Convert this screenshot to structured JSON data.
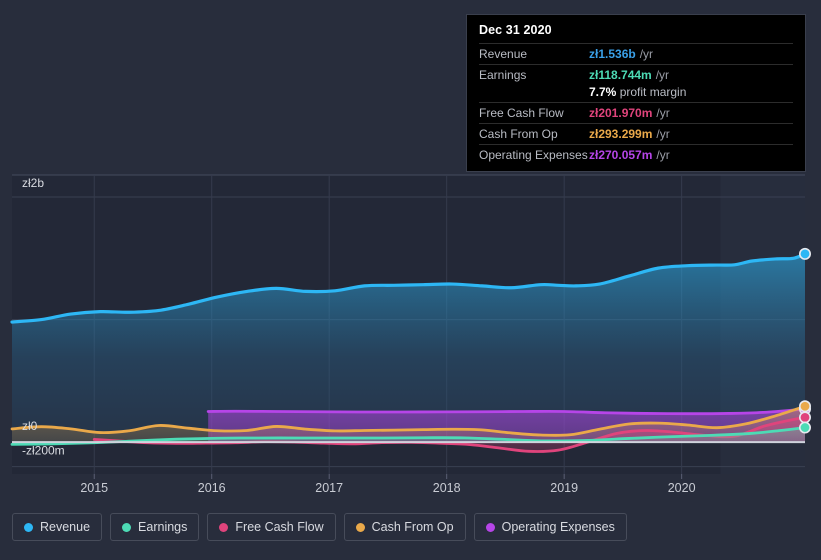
{
  "colors": {
    "background": "#282d3c",
    "plot_background": "#232837",
    "zero_line": "#cfd3dc",
    "grid": "#3a4052",
    "revenue": "#2db7f5",
    "earnings": "#4ddbb5",
    "free_cash_flow": "#e0447c",
    "cash_from_op": "#eaa94a",
    "operating_expenses": "#b645e8",
    "tooltip_bg": "#000000",
    "text": "#d9dbe1"
  },
  "tooltip": {
    "name": "chart-tooltip",
    "date": "Dec 31 2020",
    "rows": [
      {
        "label": "Revenue",
        "value": "zł1.536b",
        "unit": "/yr",
        "color": "#3aa0e8"
      },
      {
        "label": "Earnings",
        "value": "zł118.744m",
        "unit": "/yr",
        "color": "#4ddbb5"
      },
      {
        "label": "Free Cash Flow",
        "value": "zł201.970m",
        "unit": "/yr",
        "color": "#e0447c"
      },
      {
        "label": "Cash From Op",
        "value": "zł293.299m",
        "unit": "/yr",
        "color": "#eaa94a"
      },
      {
        "label": "Operating Expenses",
        "value": "zł270.057m",
        "unit": "/yr",
        "color": "#b645e8"
      }
    ],
    "profit_margin_value": "7.7%",
    "profit_margin_label": "profit margin"
  },
  "legend": {
    "items": [
      {
        "label": "Revenue",
        "color": "#2db7f5"
      },
      {
        "label": "Earnings",
        "color": "#4ddbb5"
      },
      {
        "label": "Free Cash Flow",
        "color": "#e0447c"
      },
      {
        "label": "Cash From Op",
        "color": "#eaa94a"
      },
      {
        "label": "Operating Expenses",
        "color": "#b645e8"
      }
    ]
  },
  "chart_data": {
    "type": "area",
    "title": "",
    "xlabel": "",
    "ylabel": "",
    "currency": "zł",
    "x_tick_labels": [
      "2015",
      "2016",
      "2017",
      "2018",
      "2019",
      "2020"
    ],
    "x_tick_values": [
      2015,
      2016,
      2017,
      2018,
      2019,
      2020
    ],
    "y_tick_labels": [
      "zł2b",
      "zł0",
      "-zł200m"
    ],
    "y_tick_values": [
      2000,
      0,
      -200
    ],
    "y_units": "millions",
    "ylim": [
      -260,
      2180
    ],
    "xlim": [
      2014.3,
      2021.05
    ],
    "grid": true,
    "legend_position": "bottom",
    "zero_line": 0,
    "forecast_start": 2020.33,
    "series": [
      {
        "name": "Revenue",
        "key": "revenue",
        "color": "#2db7f5",
        "filled": true,
        "points": [
          [
            2014.3,
            980
          ],
          [
            2014.55,
            1000
          ],
          [
            2014.8,
            1045
          ],
          [
            2015.05,
            1065
          ],
          [
            2015.3,
            1060
          ],
          [
            2015.55,
            1075
          ],
          [
            2015.8,
            1125
          ],
          [
            2016.05,
            1185
          ],
          [
            2016.3,
            1230
          ],
          [
            2016.55,
            1255
          ],
          [
            2016.8,
            1230
          ],
          [
            2017.05,
            1235
          ],
          [
            2017.3,
            1275
          ],
          [
            2017.55,
            1280
          ],
          [
            2017.8,
            1285
          ],
          [
            2018.05,
            1290
          ],
          [
            2018.3,
            1275
          ],
          [
            2018.55,
            1260
          ],
          [
            2018.8,
            1285
          ],
          [
            2018.95,
            1280
          ],
          [
            2019.1,
            1275
          ],
          [
            2019.3,
            1290
          ],
          [
            2019.55,
            1355
          ],
          [
            2019.8,
            1420
          ],
          [
            2020.05,
            1440
          ],
          [
            2020.3,
            1445
          ],
          [
            2020.45,
            1447
          ],
          [
            2020.6,
            1478
          ],
          [
            2020.8,
            1495
          ],
          [
            2020.95,
            1500
          ],
          [
            2021.05,
            1536
          ]
        ],
        "end_marker": {
          "value": 1536,
          "x": 2021.05
        }
      },
      {
        "name": "Operating Expenses",
        "key": "operating_expenses",
        "color": "#b645e8",
        "filled": true,
        "points": [
          [
            2015.97,
            250
          ],
          [
            2016.2,
            252
          ],
          [
            2016.55,
            250
          ],
          [
            2016.9,
            248
          ],
          [
            2017.25,
            246
          ],
          [
            2017.6,
            246
          ],
          [
            2017.95,
            247
          ],
          [
            2018.3,
            248
          ],
          [
            2018.65,
            250
          ],
          [
            2019.0,
            250
          ],
          [
            2019.35,
            240
          ],
          [
            2019.7,
            234
          ],
          [
            2020.05,
            232
          ],
          [
            2020.4,
            234
          ],
          [
            2020.7,
            243
          ],
          [
            2021.05,
            270
          ]
        ],
        "end_marker": {
          "value": 270,
          "x": 2021.05
        }
      },
      {
        "name": "Cash From Op",
        "key": "cash_from_op",
        "color": "#eaa94a",
        "filled": true,
        "points": [
          [
            2014.3,
            108
          ],
          [
            2014.55,
            126
          ],
          [
            2014.8,
            108
          ],
          [
            2015.05,
            78
          ],
          [
            2015.3,
            93
          ],
          [
            2015.55,
            136
          ],
          [
            2015.8,
            114
          ],
          [
            2016.05,
            93
          ],
          [
            2016.3,
            95
          ],
          [
            2016.55,
            128
          ],
          [
            2016.8,
            106
          ],
          [
            2017.05,
            92
          ],
          [
            2017.3,
            95
          ],
          [
            2017.55,
            98
          ],
          [
            2017.8,
            102
          ],
          [
            2018.05,
            105
          ],
          [
            2018.3,
            100
          ],
          [
            2018.55,
            75
          ],
          [
            2018.8,
            58
          ],
          [
            2019.05,
            60
          ],
          [
            2019.3,
            105
          ],
          [
            2019.55,
            148
          ],
          [
            2019.8,
            155
          ],
          [
            2020.05,
            140
          ],
          [
            2020.3,
            118
          ],
          [
            2020.55,
            150
          ],
          [
            2020.8,
            215
          ],
          [
            2021.05,
            293
          ]
        ],
        "end_marker": {
          "value": 293,
          "x": 2021.05
        }
      },
      {
        "name": "Free Cash Flow",
        "key": "free_cash_flow",
        "color": "#e0447c",
        "filled": true,
        "points": [
          [
            2015.0,
            22
          ],
          [
            2015.2,
            10
          ],
          [
            2015.45,
            -5
          ],
          [
            2015.7,
            -10
          ],
          [
            2015.95,
            -8
          ],
          [
            2016.2,
            -5
          ],
          [
            2016.45,
            3
          ],
          [
            2016.7,
            0
          ],
          [
            2016.95,
            -8
          ],
          [
            2017.2,
            -14
          ],
          [
            2017.45,
            -4
          ],
          [
            2017.7,
            -2
          ],
          [
            2017.95,
            -9
          ],
          [
            2018.2,
            -20
          ],
          [
            2018.45,
            -48
          ],
          [
            2018.7,
            -75
          ],
          [
            2018.95,
            -65
          ],
          [
            2019.2,
            0
          ],
          [
            2019.45,
            72
          ],
          [
            2019.7,
            95
          ],
          [
            2019.95,
            80
          ],
          [
            2020.2,
            55
          ],
          [
            2020.45,
            48
          ],
          [
            2020.7,
            130
          ],
          [
            2020.9,
            175
          ],
          [
            2021.05,
            202
          ]
        ],
        "end_marker": {
          "value": 202,
          "x": 2021.05
        }
      },
      {
        "name": "Earnings",
        "key": "earnings",
        "color": "#4ddbb5",
        "filled": true,
        "points": [
          [
            2014.3,
            -18
          ],
          [
            2014.65,
            -14
          ],
          [
            2015.0,
            -5
          ],
          [
            2015.35,
            10
          ],
          [
            2015.7,
            24
          ],
          [
            2016.05,
            32
          ],
          [
            2016.4,
            34
          ],
          [
            2016.75,
            34
          ],
          [
            2017.1,
            34
          ],
          [
            2017.45,
            34
          ],
          [
            2017.8,
            36
          ],
          [
            2018.15,
            35
          ],
          [
            2018.5,
            22
          ],
          [
            2018.85,
            10
          ],
          [
            2019.2,
            14
          ],
          [
            2019.55,
            30
          ],
          [
            2019.9,
            44
          ],
          [
            2020.25,
            55
          ],
          [
            2020.6,
            72
          ],
          [
            2020.85,
            96
          ],
          [
            2021.05,
            119
          ]
        ],
        "end_marker": {
          "value": 119,
          "x": 2021.05
        }
      }
    ]
  }
}
